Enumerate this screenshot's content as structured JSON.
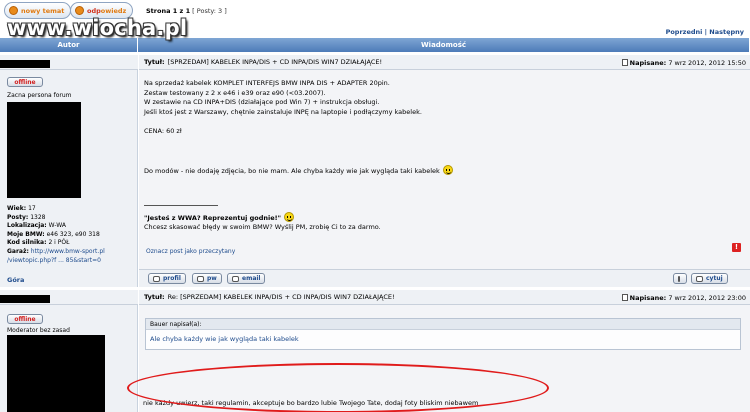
{
  "toolbar": {
    "new_topic": "nowy temat",
    "reply_a": "odp",
    "reply_b": "owiedz"
  },
  "pagination": {
    "page": "Strona 1 z 1",
    "posts": "[ Posty: 3 ]"
  },
  "logo": "www.wiocha.pl",
  "topic_nav": {
    "prev_next": "Poprzedni | Następny"
  },
  "columns": {
    "author": "Autor",
    "message": "Wiadomość"
  },
  "posts": [
    {
      "status": "offline",
      "rank": "Zacna persona forum",
      "stats": {
        "wiek_label": "Wiek:",
        "wiek": "17",
        "posty_label": "Posty:",
        "posty": "1328",
        "lok_label": "Lokalizacja:",
        "lok": "W-WA",
        "bmw_label": "Moje BMW:",
        "bmw": "e46 323, e90 318",
        "kod_label": "Kod silnika:",
        "kod": "2 i PÓŁ",
        "garaz_label": "Garaż:",
        "garaz1": "http://www.bmw-sport.pl",
        "garaz2": "/viewtopic.php?f ... 85&start=0"
      },
      "title_label": "Tytuł:",
      "title": "[SPRZEDAM] KABELEK INPA/DIS + CD INPA/DIS WIN7 DZIAŁAJĄCE!",
      "date_label": "Napisane:",
      "date": "7 wrz 2012, 2012 15:50",
      "body": [
        "Na sprzedaż kabelek KOMPLET INTERFEJS BMW INPA DIS + ADAPTER 20pin.",
        "Zestaw testowany z 2 x e46 i e39 oraz e90 (<03.2007).",
        "W zestawie na CD INPA+DIS (działające pod Win 7) + instrukcja obsługi.",
        "Jeśli ktoś jest z Warszawy, chętnie zainstaluje INPĘ na laptopie i podłączymy kabelek.",
        "",
        "CENA: 60 zł",
        "",
        "",
        "",
        "Do modów - nie dodaję zdjęcia, bo nie mam. Ale chyba każdy wie jak wygląda taki kabelek"
      ],
      "signature": "\"Jesteś z WWA? Reprezentuj godnie!\"",
      "signature_sub": "Chcesz skasować błędy w swoim BMW? Wyślij PM, zrobię Ci to za darmo.",
      "report": "Oznacz post jako przeczytany",
      "gora": "Góra",
      "buttons": {
        "profil": "profil",
        "pw": "pw",
        "email": "email",
        "cytuj": "cytuj"
      }
    },
    {
      "status": "offline",
      "rank": "Moderator bez zasad",
      "title_label": "Tytuł:",
      "title": "Re: [SPRZEDAM] KABELEK INPA/DIS + CD INPA/DIS WIN7 DZIAŁAJĄCE!",
      "date_label": "Napisane:",
      "date": "7 wrz 2012, 2012 23:00",
      "quote_head": "Bauer napisał(a):",
      "quote_body": "Ale chyba każdy wie jak wygląda taki kabelek",
      "reply": "nie każdy uwierz, taki regulamin, akceptuje bo bardzo lubie Twojego Tate, dodaj foty bliskim niebawem"
    }
  ],
  "colors": {
    "header": "#4d7bb8",
    "link": "#1e4b8c",
    "annotation": "#e01b1b",
    "offline": "#d02020"
  },
  "icons": [
    "smiley-icon",
    "report-icon",
    "document-icon"
  ]
}
